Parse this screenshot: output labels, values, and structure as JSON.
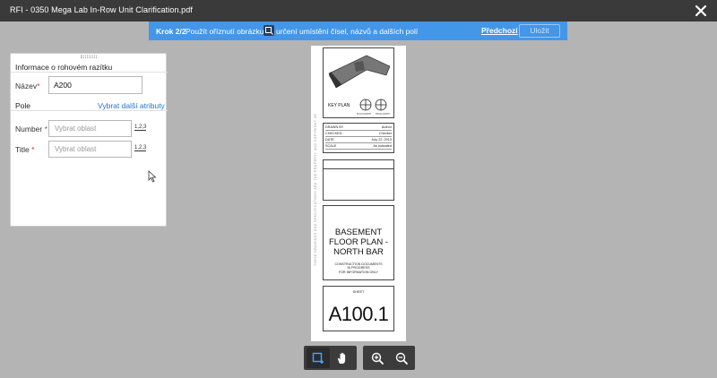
{
  "window": {
    "title": "RFI - 0350 Mega Lab In-Row Unit Clarification.pdf"
  },
  "stepbar": {
    "step": "Krok 2/2",
    "message_part1": "Použít oříznutí obrázku",
    "message_part2": "určení umístění čísel, názvů a dalších polí",
    "prev_label": "Předchozí",
    "save_label": "Uložit"
  },
  "panel": {
    "header": "Informace o rohovém razítku",
    "name_label": "Název",
    "name_value": "A200",
    "fields_label": "Pole",
    "more_attrs": "Vybrat další atributy",
    "fields": [
      {
        "label": "Number",
        "placeholder": "Vybrat oblast",
        "format": "1,2,3"
      },
      {
        "label": "Title",
        "placeholder": "Vybrat oblast",
        "format": "1,2,3"
      }
    ]
  },
  "sheet": {
    "vertical_text": "THESE DRAWINGS AND SPECIFICATIONS ARE THE PROPERTY AND COPYRIGHT OF",
    "key_plan": "KEY PLAN",
    "north1": "PLAN NORTH",
    "north2": "TRUE NORTH",
    "info": [
      {
        "k": "DRAWN BY",
        "v": "Author"
      },
      {
        "k": "CHECKED",
        "v": "Checker"
      },
      {
        "k": "DATE",
        "v": "July 22, 2013"
      },
      {
        "k": "SCALE",
        "v": "As indicated"
      }
    ],
    "title_lines": [
      "BASEMENT",
      "FLOOR PLAN -",
      "NORTH BAR"
    ],
    "status_lines": [
      "CONSTRUCTION DOCUMENTS",
      "IN PROGRESS",
      "FOR INFORMATION ONLY"
    ],
    "sheet_label": "SHEET",
    "sheet_number": "A100.1"
  },
  "colors": {
    "accent": "#4396e8",
    "titlebar": "#3a3a3a",
    "canvas": "#b4b4b4",
    "link": "#2a73c9",
    "required": "#dd3333"
  }
}
